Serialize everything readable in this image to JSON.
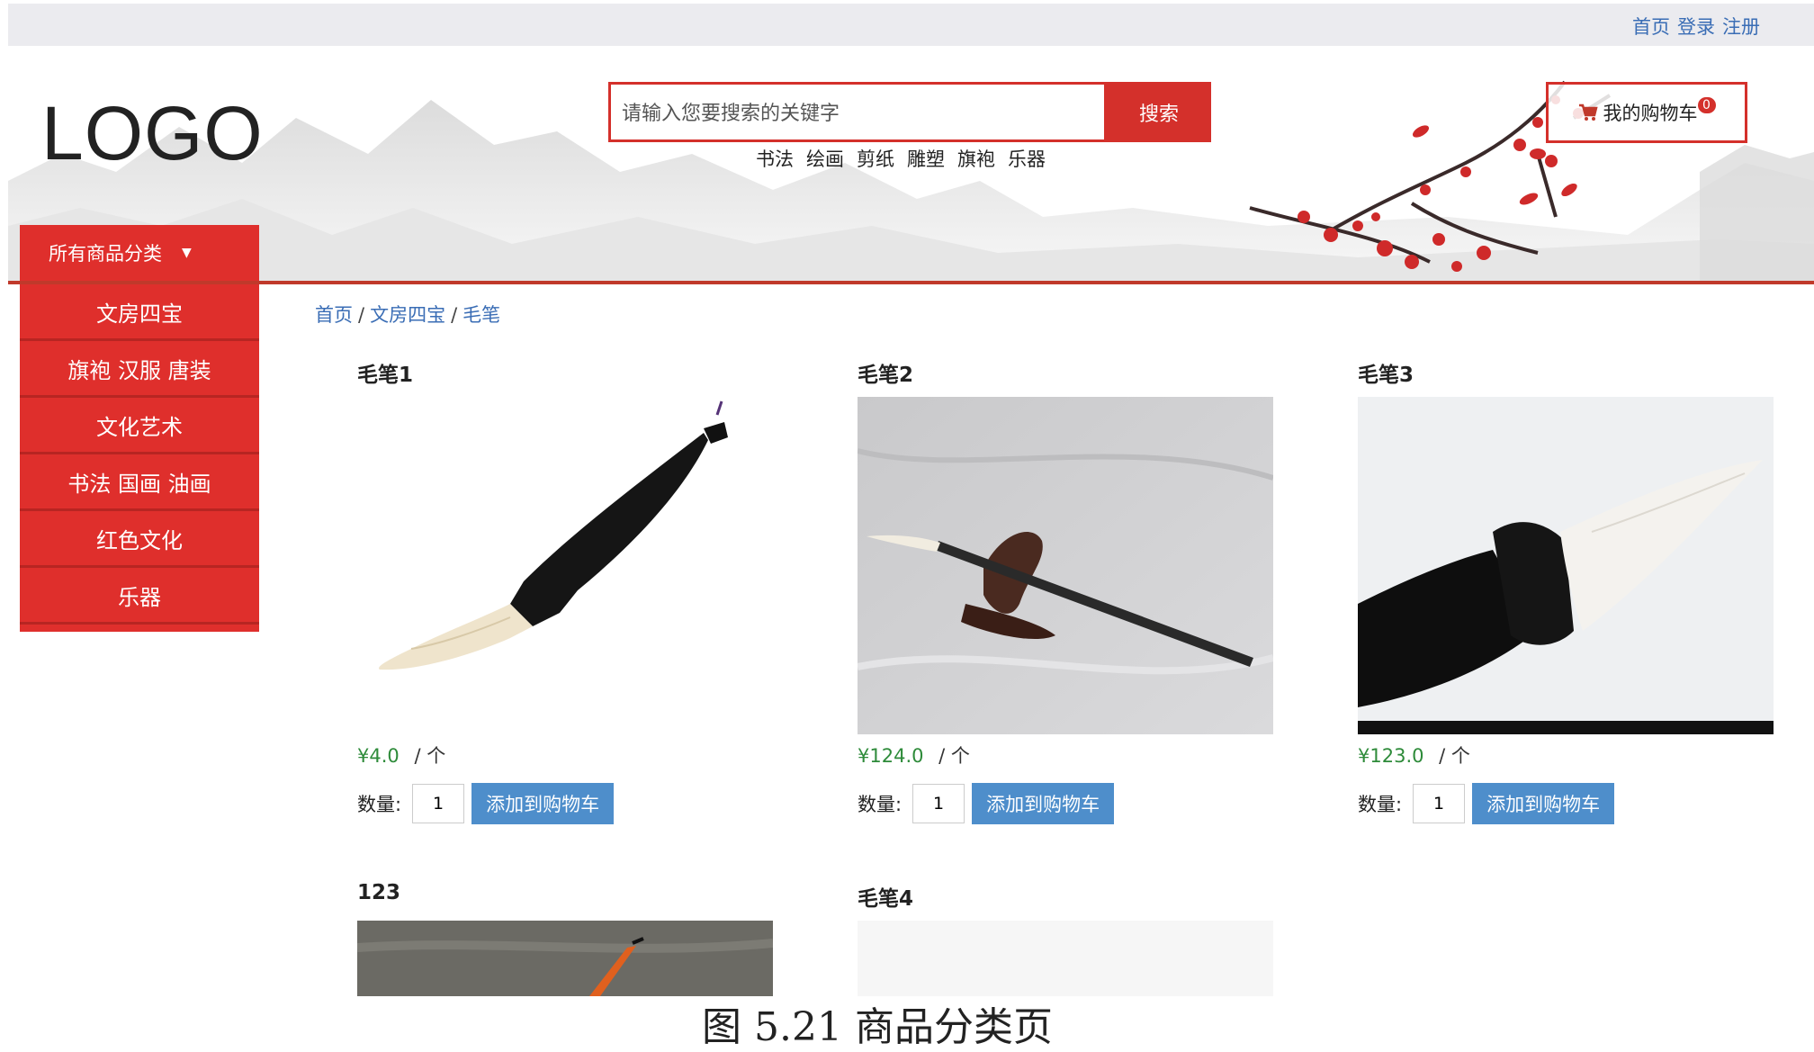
{
  "top_nav": {
    "links": [
      "首页",
      "登录",
      "注册"
    ]
  },
  "header": {
    "logo": "LOGO",
    "search": {
      "placeholder": "请输入您要搜索的关键字",
      "button": "搜索"
    },
    "hot_words": [
      "书法",
      "绘画",
      "剪纸",
      "雕塑",
      "旗袍",
      "乐器"
    ],
    "cart": {
      "label": "我的购物车",
      "count": "0"
    }
  },
  "category_menu": {
    "title": "所有商品分类",
    "items": [
      "文房四宝",
      "旗袍 汉服 唐装",
      "文化艺术",
      "书法 国画 油画",
      "红色文化",
      "乐器"
    ]
  },
  "breadcrumb": [
    "首页",
    "文房四宝",
    "毛笔"
  ],
  "labels": {
    "quantity": "数量:",
    "add_to_cart": "添加到购物车",
    "unit": "/ 个"
  },
  "products": [
    {
      "title": "毛笔1",
      "price": "¥4.0",
      "qty": "1"
    },
    {
      "title": "毛笔2",
      "price": "¥124.0",
      "qty": "1"
    },
    {
      "title": "毛笔3",
      "price": "¥123.0",
      "qty": "1"
    },
    {
      "title": "123"
    },
    {
      "title": "毛笔4"
    }
  ],
  "caption": "图 5.21 商品分类页",
  "colors": {
    "accent_red": "#df2f2c",
    "link_blue": "#3a6db5",
    "button_blue": "#4e8ecb",
    "price_green": "#2e8b3a"
  }
}
